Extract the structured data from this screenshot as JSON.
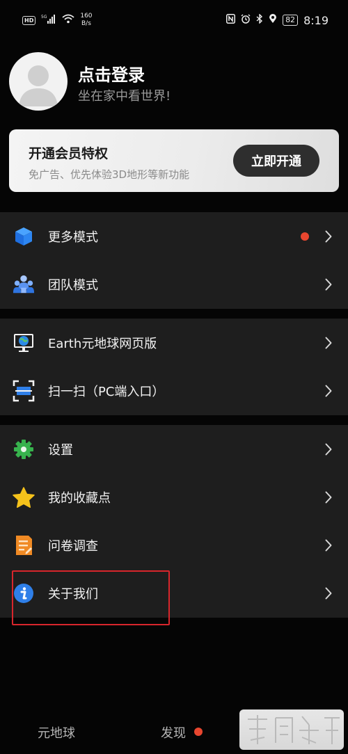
{
  "status_bar": {
    "hd_badge": "HD",
    "speed_value": "160",
    "speed_unit": "B/s",
    "battery": "82",
    "time": "8:19"
  },
  "profile": {
    "name": "点击登录",
    "slogan": "坐在家中看世界!"
  },
  "vip": {
    "title": "开通会员特权",
    "description": "免广告、优先体验3D地形等新功能",
    "button_label": "立即开通"
  },
  "menu_groups": [
    [
      {
        "label": "更多模式",
        "icon": "cube-icon",
        "badge": true
      },
      {
        "label": "团队模式",
        "icon": "team-icon",
        "badge": false
      }
    ],
    [
      {
        "label": "Earth元地球网页版",
        "icon": "monitor-globe-icon",
        "badge": false
      },
      {
        "label": "扫一扫（PC端入口）",
        "icon": "scan-icon",
        "badge": false
      }
    ],
    [
      {
        "label": "设置",
        "icon": "gear-icon",
        "badge": false
      },
      {
        "label": "我的收藏点",
        "icon": "star-icon",
        "badge": false
      },
      {
        "label": "问卷调查",
        "icon": "survey-icon",
        "badge": false
      },
      {
        "label": "关于我们",
        "icon": "info-icon",
        "badge": false
      }
    ]
  ],
  "tabs": [
    {
      "label": "元地球",
      "badge": false
    },
    {
      "label": "发现",
      "badge": true
    }
  ],
  "colors": {
    "background": "#050505",
    "group_background": "#1e1e1e",
    "badge_red": "#e8462f",
    "highlight_red": "#d8262c"
  }
}
